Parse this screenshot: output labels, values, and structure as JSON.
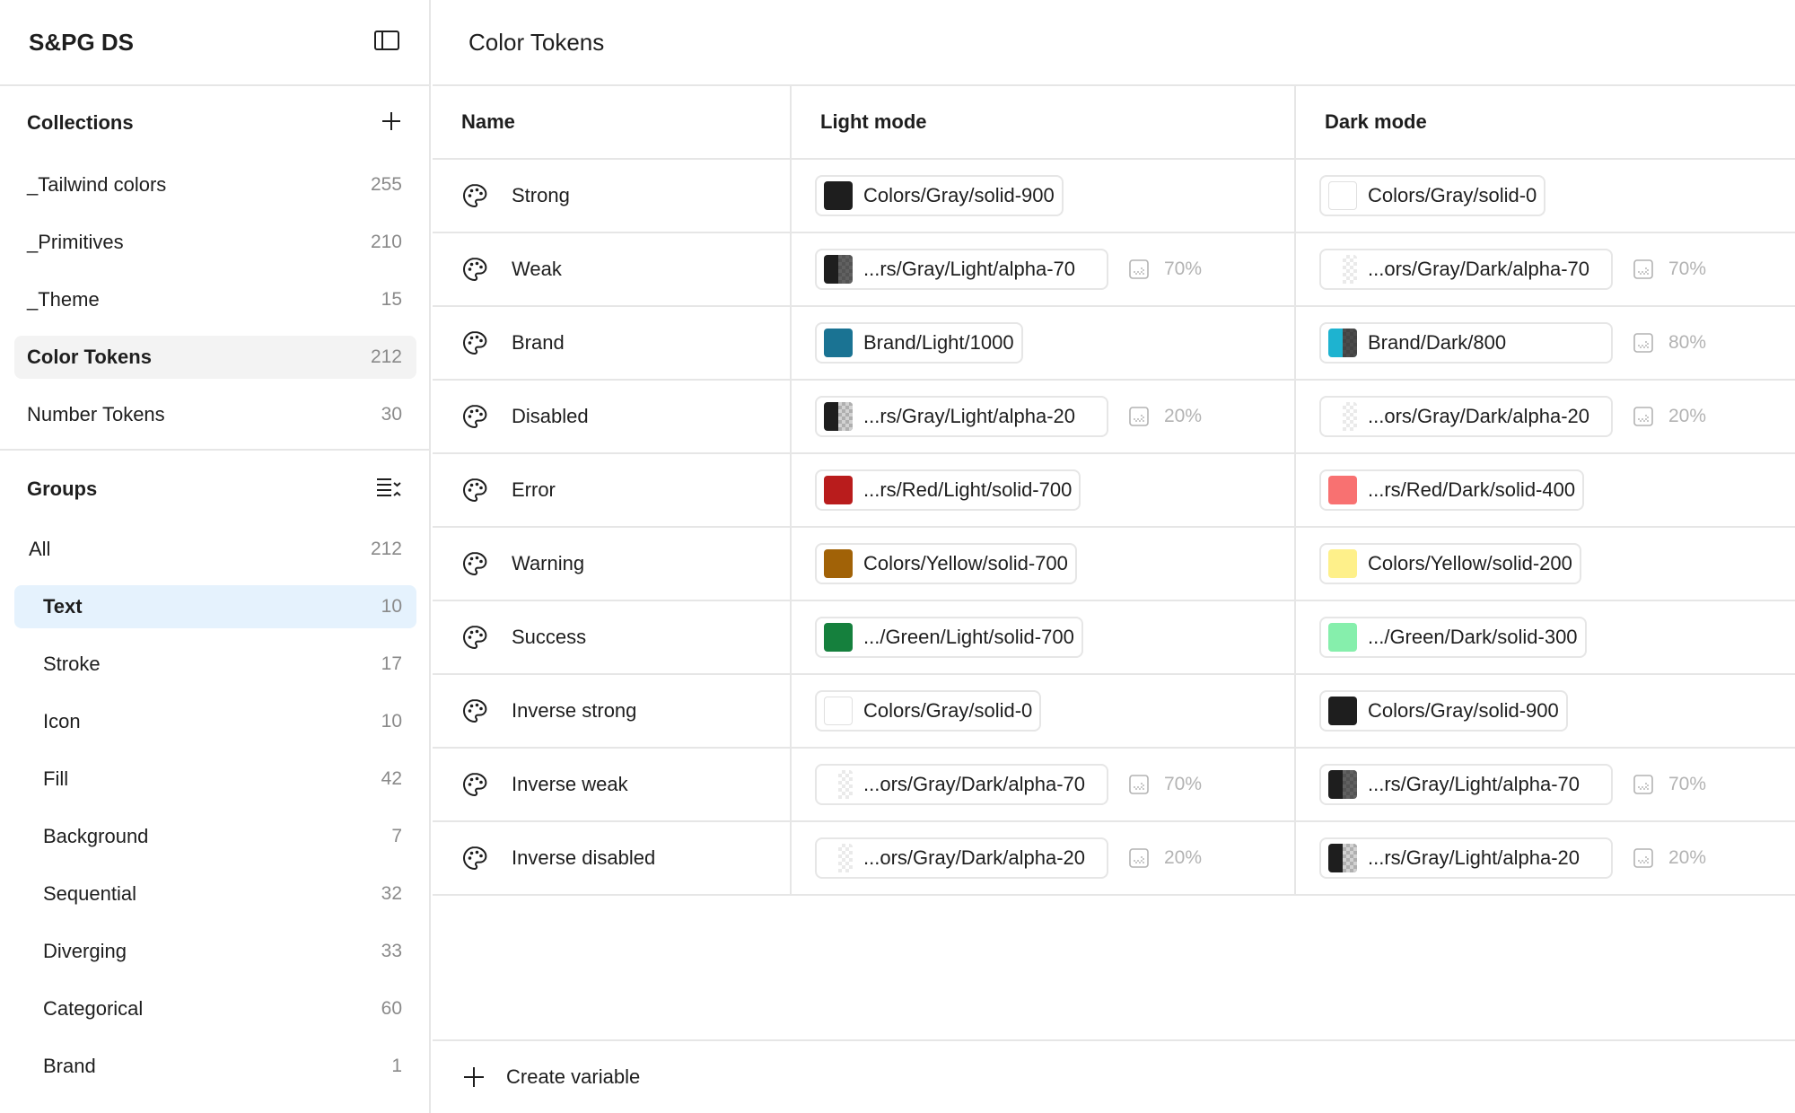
{
  "app": {
    "title": "S&PG DS"
  },
  "collections": {
    "title": "Collections",
    "items": [
      {
        "label": "_Tailwind colors",
        "count": "255"
      },
      {
        "label": "_Primitives",
        "count": "210"
      },
      {
        "label": "_Theme",
        "count": "15"
      },
      {
        "label": "Color Tokens",
        "count": "212"
      },
      {
        "label": "Number Tokens",
        "count": "30"
      }
    ]
  },
  "groups": {
    "title": "Groups",
    "items": [
      {
        "label": "All",
        "count": "212"
      },
      {
        "label": "Text",
        "count": "10"
      },
      {
        "label": "Stroke",
        "count": "17"
      },
      {
        "label": "Icon",
        "count": "10"
      },
      {
        "label": "Fill",
        "count": "42"
      },
      {
        "label": "Background",
        "count": "7"
      },
      {
        "label": "Sequential",
        "count": "32"
      },
      {
        "label": "Diverging",
        "count": "33"
      },
      {
        "label": "Categorical",
        "count": "60"
      },
      {
        "label": "Brand",
        "count": "1"
      }
    ]
  },
  "main": {
    "title": "Color Tokens",
    "columns": {
      "name": "Name",
      "light": "Light mode",
      "dark": "Dark mode"
    },
    "rows": [
      {
        "name": "Strong",
        "light": {
          "label": "Colors/Gray/solid-900",
          "color": "#1e1e1e",
          "alpha": ""
        },
        "dark": {
          "label": "Colors/Gray/solid-0",
          "color": "#ffffff",
          "alpha": ""
        }
      },
      {
        "name": "Weak",
        "light": {
          "label": "...rs/Gray/Light/alpha-70",
          "color": "#1e1e1e",
          "alpha": "70%"
        },
        "dark": {
          "label": "...ors/Gray/Dark/alpha-70",
          "color": "#ffffff",
          "alpha": "70%"
        }
      },
      {
        "name": "Brand",
        "light": {
          "label": "Brand/Light/1000",
          "color": "#1a7393",
          "alpha": ""
        },
        "dark": {
          "label": "Brand/Dark/800",
          "color": "#1eb3d0",
          "alpha": "80%"
        }
      },
      {
        "name": "Disabled",
        "light": {
          "label": "...rs/Gray/Light/alpha-20",
          "color": "#1e1e1e",
          "alpha": "20%"
        },
        "dark": {
          "label": "...ors/Gray/Dark/alpha-20",
          "color": "#ffffff",
          "alpha": "20%"
        }
      },
      {
        "name": "Error",
        "light": {
          "label": "...rs/Red/Light/solid-700",
          "color": "#b91c1c",
          "alpha": ""
        },
        "dark": {
          "label": "...rs/Red/Dark/solid-400",
          "color": "#f87171",
          "alpha": ""
        }
      },
      {
        "name": "Warning",
        "light": {
          "label": "Colors/Yellow/solid-700",
          "color": "#a16207",
          "alpha": ""
        },
        "dark": {
          "label": "Colors/Yellow/solid-200",
          "color": "#fef08a",
          "alpha": ""
        }
      },
      {
        "name": "Success",
        "light": {
          "label": ".../Green/Light/solid-700",
          "color": "#15803d",
          "alpha": ""
        },
        "dark": {
          "label": ".../Green/Dark/solid-300",
          "color": "#86efac",
          "alpha": ""
        }
      },
      {
        "name": "Inverse strong",
        "light": {
          "label": "Colors/Gray/solid-0",
          "color": "#ffffff",
          "alpha": ""
        },
        "dark": {
          "label": "Colors/Gray/solid-900",
          "color": "#1e1e1e",
          "alpha": ""
        }
      },
      {
        "name": "Inverse weak",
        "light": {
          "label": "...ors/Gray/Dark/alpha-70",
          "color": "#ffffff",
          "alpha": "70%"
        },
        "dark": {
          "label": "...rs/Gray/Light/alpha-70",
          "color": "#1e1e1e",
          "alpha": "70%"
        }
      },
      {
        "name": "Inverse disabled",
        "light": {
          "label": "...ors/Gray/Dark/alpha-20",
          "color": "#ffffff",
          "alpha": "20%"
        },
        "dark": {
          "label": "...rs/Gray/Light/alpha-20",
          "color": "#1e1e1e",
          "alpha": "20%"
        }
      }
    ]
  },
  "footer": {
    "create_label": "Create variable"
  }
}
